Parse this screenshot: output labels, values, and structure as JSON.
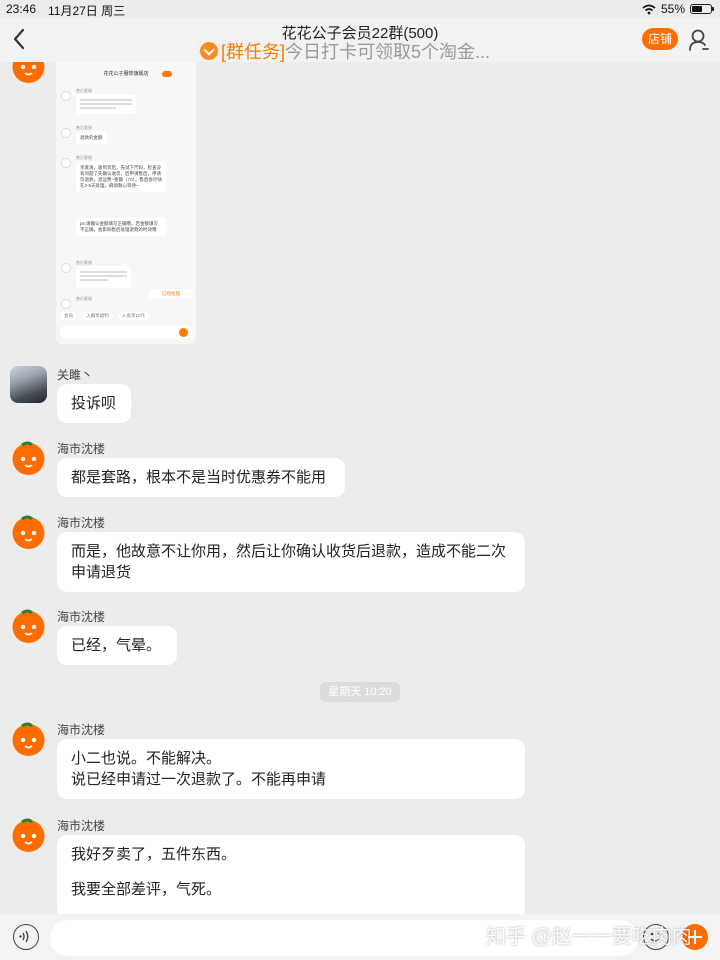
{
  "status_bar": {
    "time": "23:46",
    "date": "11月27日 周三",
    "battery": "55%",
    "battery_level": 0.55
  },
  "header": {
    "title": "花花公子会员22群(500)",
    "task_tag": "[群任务]",
    "task_text": "今日打卡可领取5个淘金...",
    "store_label": "店铺"
  },
  "screenshot": {
    "title": "花花公子服饰旗舰店",
    "agent_label": "售后客服",
    "messages": [
      "退款的金额",
      "亲爱滴，收到货后，先试下尺码，检查没有问题了先确认收货，后申请售后，申请仅退款，退运费~金额（70），售后会尽快在2-5天处理，麻烦耐心等待~",
      "ps:请确认金额填写正确哦，若金额填写不正确，会影响售后处理退款的时效哦"
    ],
    "link": "已经处理",
    "tabs": [
      "会员",
      "入群享福利",
      "入会享10元"
    ]
  },
  "messages": [
    {
      "sender": "关雎丶",
      "avatar": "photo",
      "lines": [
        "投诉呗"
      ]
    },
    {
      "sender": "海市沈楼",
      "avatar": "orange",
      "lines": [
        "都是套路，根本不是当时优惠券不能用"
      ]
    },
    {
      "sender": "海市沈楼",
      "avatar": "orange",
      "lines": [
        "而是，他故意不让你用，然后让你确认收货后退款，造成不能二次申请退货"
      ]
    },
    {
      "sender": "海市沈楼",
      "avatar": "orange",
      "lines": [
        "已经，气晕。"
      ]
    },
    {
      "sender": "海市沈楼",
      "avatar": "orange",
      "lines": [
        "小二也说。不能解决。",
        "说已经申请过一次退款了。不能再申请"
      ]
    },
    {
      "sender": "海市沈楼",
      "avatar": "orange",
      "lines": [
        "我好歹卖了，五件东西。",
        "",
        "我要全部差评，气死。"
      ]
    }
  ],
  "timestamp": "星期天 10:20",
  "input": {
    "placeholder": ""
  },
  "watermark": "知乎 @赵一一要吃肉肉",
  "icons": {
    "back": "chevron-left-icon",
    "person": "person-icon",
    "voice": "voice-icon",
    "emoji": "emoji-icon",
    "plus": "plus-icon",
    "wifi": "wifi-icon",
    "battery": "battery-icon"
  },
  "colors": {
    "accent": "#ff6d00",
    "tag": "#ff7a00",
    "background": "#ececec"
  }
}
